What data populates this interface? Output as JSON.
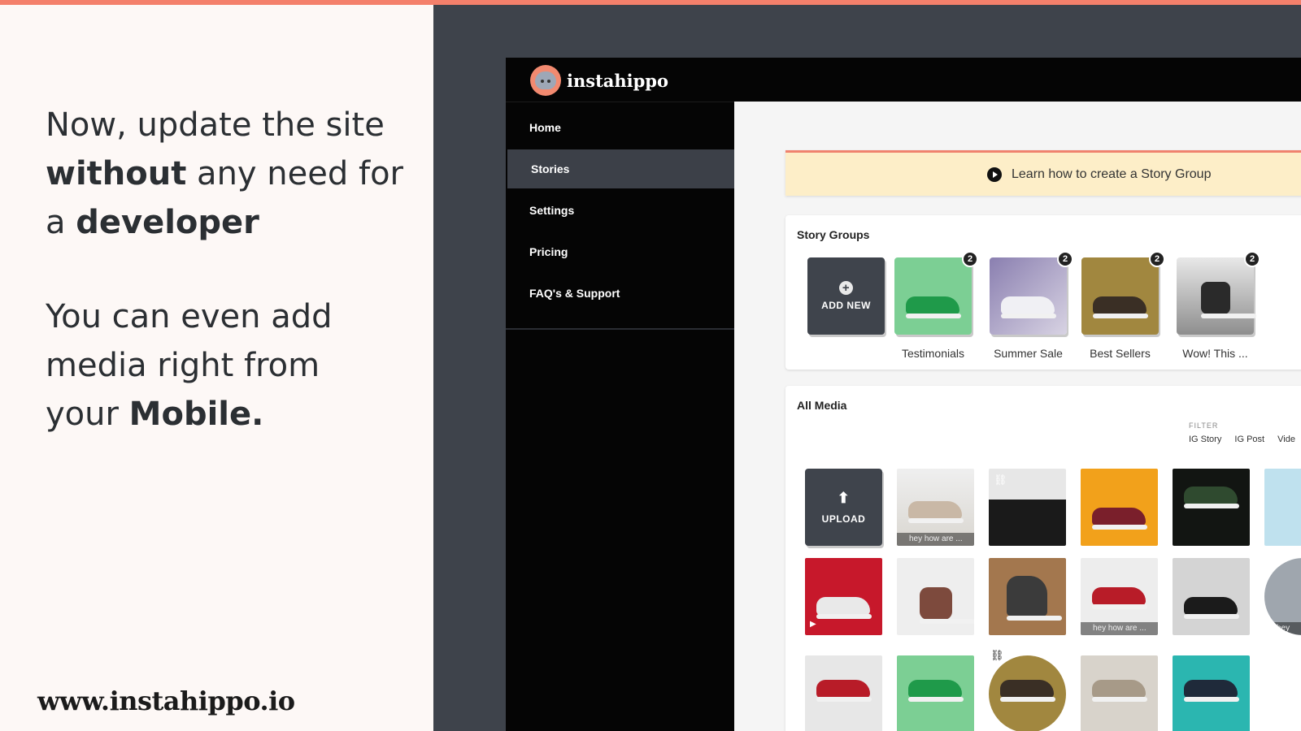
{
  "promo": {
    "line1": "Now, update the site",
    "line2_bold": "without",
    "line2_rest": " any need for",
    "line3_pre": "a ",
    "line3_bold": "developer",
    "line4": "You can even add",
    "line5": "media right from",
    "line6_pre": "your ",
    "line6_bold": "Mobile.",
    "url": "www.instahippo.io"
  },
  "app": {
    "brand": "instahippo",
    "nav": [
      {
        "label": "Home"
      },
      {
        "label": "Stories"
      },
      {
        "label": "Settings"
      },
      {
        "label": "Pricing"
      },
      {
        "label": "FAQ's & Support"
      }
    ],
    "banner": "Learn how to create a Story Group",
    "story_groups": {
      "title": "Story Groups",
      "add_new": "ADD NEW",
      "groups": [
        {
          "label": "Testimonials",
          "count": "2",
          "color": "#7ccf94"
        },
        {
          "label": "Summer Sale",
          "count": "2",
          "color": "#b9b0c8"
        },
        {
          "label": "Best Sellers",
          "count": "2",
          "color": "#a1873f"
        },
        {
          "label": "Wow! This ...",
          "count": "2",
          "color": "#cfcfcf"
        }
      ]
    },
    "all_media": {
      "title": "All Media",
      "filter_label": "FILTER",
      "filters": [
        "IG Story",
        "IG Post",
        "Vide"
      ],
      "upload": "UPLOAD",
      "captions": {
        "c1": "hey how are ...",
        "c2": "hey how are ...",
        "c3": "hey"
      }
    }
  }
}
